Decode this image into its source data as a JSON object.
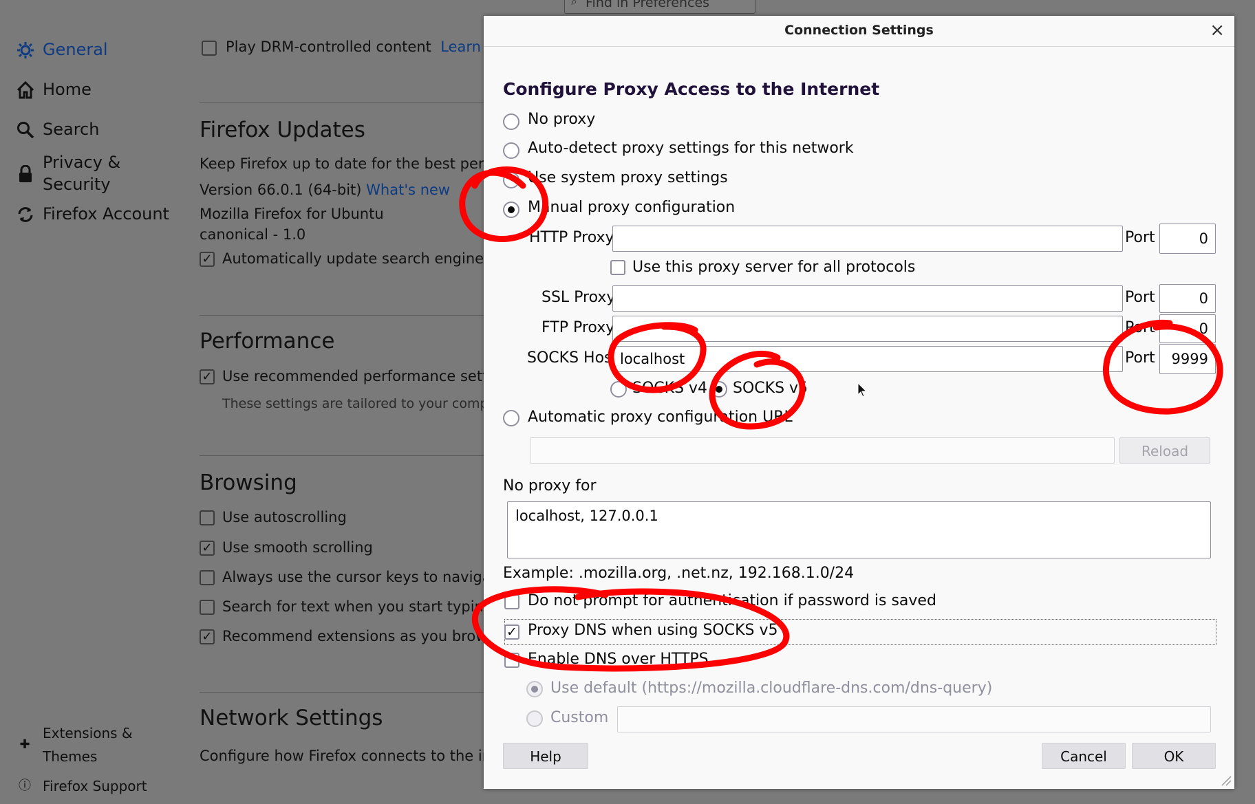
{
  "background": {
    "search": {
      "placeholder": "Find in Preferences"
    },
    "nav": [
      {
        "label": "General",
        "icon": "gear-icon"
      },
      {
        "label": "Home",
        "icon": "home-icon"
      },
      {
        "label": "Search",
        "icon": "search-icon"
      },
      {
        "label": "Privacy &",
        "label2": "Security",
        "icon": "lock-icon"
      },
      {
        "label": "Firefox Account",
        "icon": "sync-icon"
      }
    ],
    "nav_bottom": [
      {
        "label": "Extensions &",
        "label2": "Themes",
        "icon": "puzzle-icon"
      },
      {
        "label": "Firefox Support",
        "icon": "help-icon"
      }
    ],
    "drm": {
      "label": "Play DRM-controlled content",
      "link": "Learn m"
    },
    "updates": {
      "title": "Firefox Updates",
      "desc": "Keep Firefox up to date for the best perfo",
      "version": "Version 66.0.1 (64-bit)",
      "whats_new": "What's new",
      "distro1": "Mozilla Firefox for Ubuntu",
      "distro2": "canonical - 1.0",
      "auto_update": "Automatically update search engines"
    },
    "performance": {
      "title": "Performance",
      "recommended": "Use recommended performance setti",
      "note": "These settings are tailored to your compu"
    },
    "browsing": {
      "title": "Browsing",
      "items": [
        {
          "label": "Use autoscrolling",
          "checked": false
        },
        {
          "label": "Use smooth scrolling",
          "checked": true
        },
        {
          "label": "Always use the cursor keys to navigate",
          "checked": false
        },
        {
          "label": "Search for text when you start typing",
          "checked": false
        },
        {
          "label": "Recommend extensions as you brow",
          "checked": true
        }
      ]
    },
    "network": {
      "title": "Network Settings",
      "desc": "Configure how Firefox connects to the int"
    }
  },
  "dialog": {
    "title": "Connection Settings",
    "close": "×",
    "heading": "Configure Proxy Access to the Internet",
    "modes": {
      "no_proxy": "No proxy",
      "auto_detect": "Auto-detect proxy settings for this network",
      "system": "Use system proxy settings",
      "manual": "Manual proxy configuration",
      "auto_url": "Automatic proxy configuration URL"
    },
    "selected_mode": "manual",
    "http": {
      "label": "HTTP Proxy",
      "value": "",
      "port_label": "Port",
      "port": "0"
    },
    "all_protocols": {
      "label": "Use this proxy server for all protocols",
      "checked": false
    },
    "ssl": {
      "label": "SSL Proxy",
      "value": "",
      "port_label": "Port",
      "port": "0"
    },
    "ftp": {
      "label": "FTP Proxy",
      "value": "",
      "port_label": "Port",
      "port": "0"
    },
    "socks": {
      "label": "SOCKS Host",
      "value": "localhost",
      "port_label": "Port",
      "port": "9999"
    },
    "socks_v4": "SOCKS v4",
    "socks_v5": "SOCKS v5",
    "socks_version": "v5",
    "reload": "Reload",
    "pac_url": "",
    "no_proxy_for": {
      "label": "No proxy for",
      "value": "localhost, 127.0.0.1"
    },
    "example": "Example: .mozilla.org, .net.nz, 192.168.1.0/24",
    "no_prompt_auth": {
      "label": "Do not prompt for authentication if password is saved",
      "checked": false
    },
    "proxy_dns": {
      "label": "Proxy DNS when using SOCKS v5",
      "checked": true
    },
    "doh": {
      "label": "Enable DNS over HTTPS",
      "checked": false
    },
    "doh_default": "Use default (https://mozilla.cloudflare-dns.com/dns-query)",
    "doh_custom": "Custom",
    "help": "Help",
    "cancel": "Cancel",
    "ok": "OK"
  },
  "colors": {
    "annotation": "#ff0000",
    "accent": "#0a84ff"
  }
}
